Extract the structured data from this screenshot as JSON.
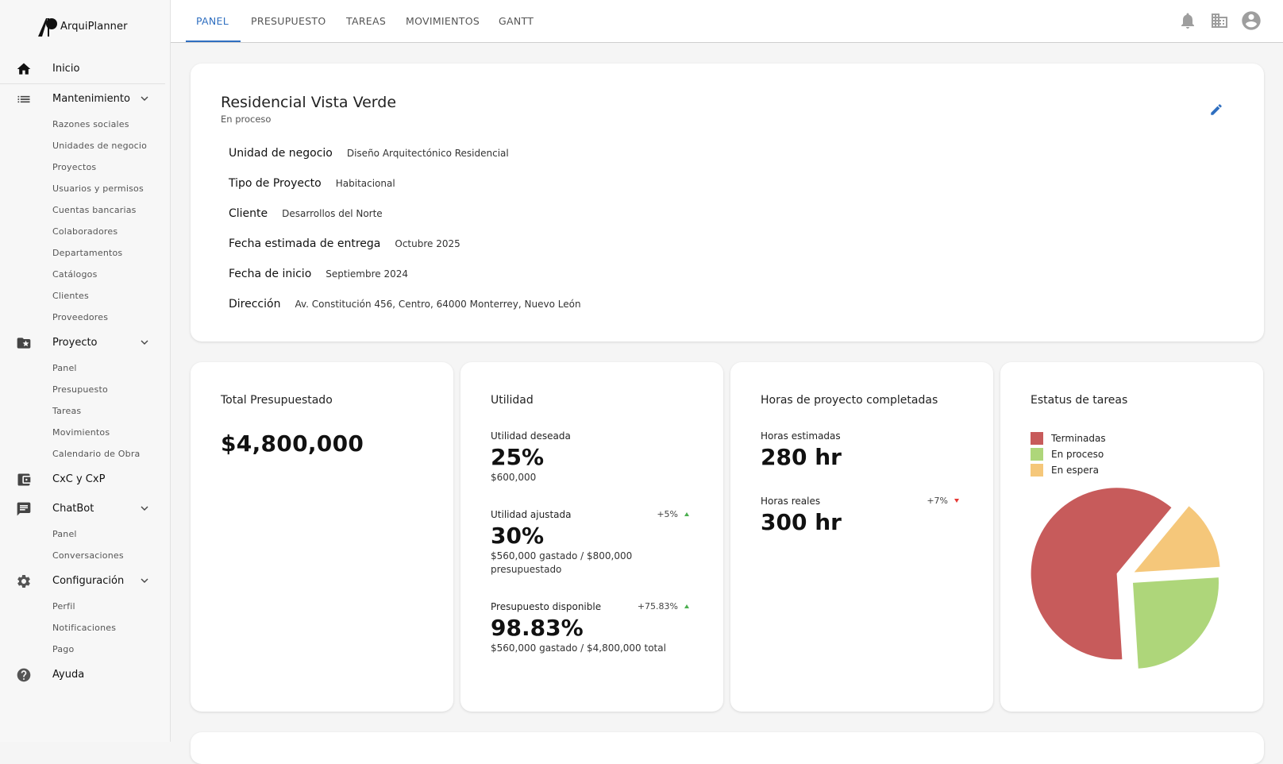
{
  "app": {
    "name": "ArquiPlanner"
  },
  "sidebar": {
    "home": "Inicio",
    "maintenance": {
      "label": "Mantenimiento",
      "items": [
        "Razones sociales",
        "Unidades de negocio",
        "Proyectos",
        "Usuarios y permisos",
        "Cuentas bancarias",
        "Colaboradores",
        "Departamentos",
        "Catálogos",
        "Clientes",
        "Proveedores"
      ]
    },
    "project": {
      "label": "Proyecto",
      "items": [
        "Panel",
        "Presupuesto",
        "Tareas",
        "Movimientos",
        "Calendario de Obra"
      ]
    },
    "cxc": "CxC y CxP",
    "chatbot": {
      "label": "ChatBot",
      "items": [
        "Panel",
        "Conversaciones"
      ]
    },
    "config": {
      "label": "Configuración",
      "items": [
        "Perfil",
        "Notificaciones",
        "Pago"
      ]
    },
    "help": "Ayuda"
  },
  "tabs": [
    "PANEL",
    "PRESUPUESTO",
    "TAREAS",
    "MOVIMIENTOS",
    "GANTT"
  ],
  "project": {
    "title": "Residencial Vista Verde",
    "status": "En proceso",
    "fields": [
      {
        "k": "Unidad de negocio",
        "v": "Diseño Arquitectónico Residencial"
      },
      {
        "k": "Tipo de Proyecto",
        "v": "Habitacional"
      },
      {
        "k": "Cliente",
        "v": "Desarrollos del Norte"
      },
      {
        "k": "Fecha estimada de entrega",
        "v": "Octubre 2025"
      },
      {
        "k": "Fecha de inicio",
        "v": "Septiembre 2024"
      },
      {
        "k": "Dirección",
        "v": "Av. Constitución 456, Centro, 64000 Monterrey, Nuevo León"
      }
    ]
  },
  "budget": {
    "title": "Total Presupuestado",
    "value": "$4,800,000"
  },
  "profit": {
    "title": "Utilidad",
    "desired": {
      "label": "Utilidad deseada",
      "value": "25%",
      "sub": "$600,000"
    },
    "adjusted": {
      "label": "Utilidad ajustada",
      "delta": "+5%",
      "value": "30%",
      "sub": "$560,000 gastado / $800,000 presupuestado"
    },
    "available": {
      "label": "Presupuesto disponible",
      "delta": "+75.83%",
      "value": "98.83%",
      "sub": "$560,000 gastado / $4,800,000 total"
    }
  },
  "hours": {
    "title": "Horas de proyecto completadas",
    "estimated": {
      "label": "Horas estimadas",
      "value": "280 hr"
    },
    "real": {
      "label": "Horas reales",
      "delta": "+7%",
      "value": "300 hr"
    }
  },
  "tasks": {
    "title": "Estatus de tareas",
    "legend": [
      "Terminadas",
      "En proceso",
      "En espera"
    ]
  },
  "colors": {
    "accent": "#2f6fc0",
    "done": "#c75b5b",
    "progress": "#aed67a",
    "waiting": "#f5c77a"
  },
  "chart_data": {
    "type": "pie",
    "categories": [
      "Terminadas",
      "En proceso",
      "En espera"
    ],
    "values": [
      62,
      25,
      13
    ],
    "colors": [
      "#c75b5b",
      "#aed67a",
      "#f5c77a"
    ],
    "legend_position": "top-left",
    "exploded": true
  }
}
